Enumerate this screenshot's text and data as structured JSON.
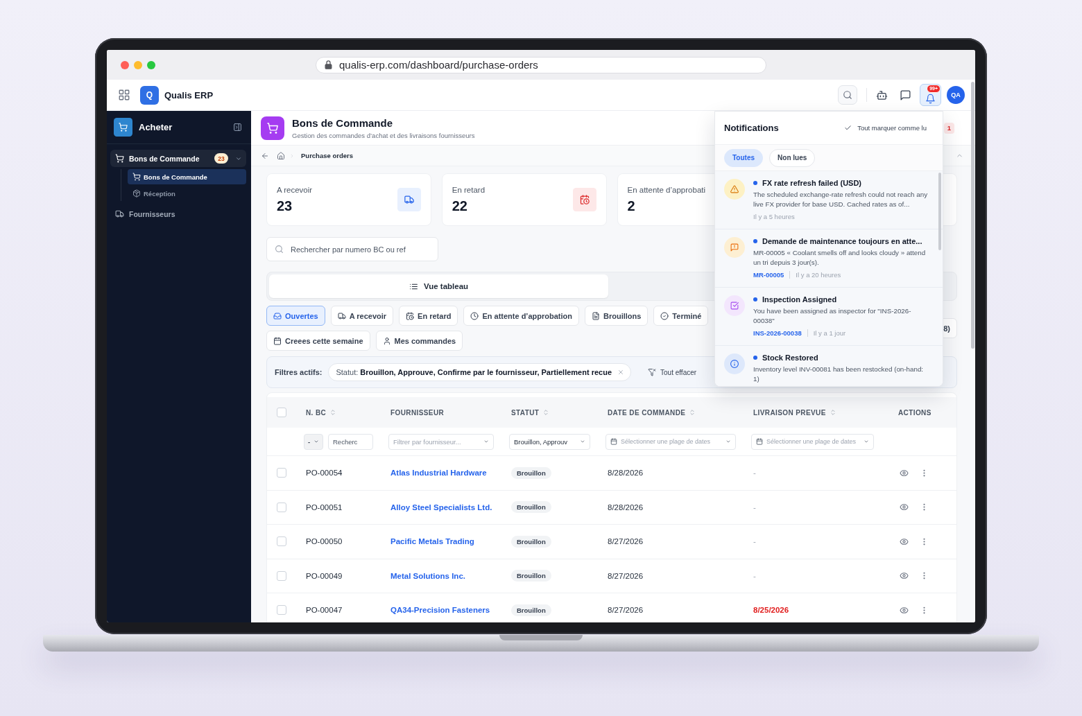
{
  "browser": {
    "url": "qualis-erp.com/dashboard/purchase-orders"
  },
  "app_header": {
    "logo": "Q",
    "brand": "Qualis ERP",
    "notification_count": "99+",
    "avatar": "QA"
  },
  "sidebar": {
    "title": "Acheter",
    "items": [
      {
        "label": "Bons de Commande",
        "badge": "23",
        "selected": true,
        "expanded": true,
        "children": [
          {
            "label": "Bons de Commande",
            "selected": true
          },
          {
            "label": "Réception",
            "selected": false
          }
        ]
      },
      {
        "label": "Fournisseurs",
        "selected": false
      }
    ]
  },
  "page_header": {
    "title": "Bons de Commande",
    "subtitle": "Gestion des commandes d’achat et des livraisons fournisseurs",
    "badge": "1"
  },
  "breadcrumb": {
    "current": "Purchase orders"
  },
  "stat_cards": [
    {
      "label": "A recevoir",
      "value": "23"
    },
    {
      "label": "En retard",
      "value": "22"
    },
    {
      "label": "En attente d’approbati",
      "value": "2"
    }
  ],
  "search": {
    "placeholder": "Rechercher par numero BC ou ref"
  },
  "view_toggle": [
    {
      "label": "Vue tableau",
      "selected": true
    }
  ],
  "filter_tabs": [
    {
      "label": "Ouvertes",
      "selected": true
    },
    {
      "label": "A recevoir",
      "selected": false
    },
    {
      "label": "En retard",
      "selected": false
    },
    {
      "label": "En attente d’approbation",
      "selected": false
    },
    {
      "label": "Brouillons",
      "selected": false
    },
    {
      "label": "Terminé",
      "selected": false
    },
    {
      "label": "Creees cette semaine",
      "selected": false
    },
    {
      "label": "Mes commandes",
      "selected": false
    }
  ],
  "right_tab": {
    "label": "8)"
  },
  "active_filters": {
    "label": "Filtres actifs:",
    "chips": [
      "Statut: **Brouillon, Approuve, Confirme par le fournisseur, Partiellement recue**"
    ],
    "clear": "Tout effacer"
  },
  "table": {
    "select_all_checked": false,
    "columns": [
      {
        "label": "N. BC",
        "sortable": true
      },
      {
        "label": "FOURNISSEUR",
        "sortable": false
      },
      {
        "label": "STATUT",
        "sortable": true
      },
      {
        "label": "DATE DE COMMANDE",
        "sortable": true
      },
      {
        "label": "LIVRAISON PREVUE",
        "sortable": true
      },
      {
        "label": "ACTIONS",
        "sortable": false
      }
    ],
    "column_filters": [
      {
        "kind": "text",
        "operator": "-",
        "placeholder": "Recherc"
      },
      {
        "kind": "select",
        "placeholder": "Filtrer par fournisseur..."
      },
      {
        "kind": "select",
        "value": "Brouillon, Approuv"
      },
      {
        "kind": "date_range",
        "placeholder": "Sélectionner une plage de dates"
      },
      {
        "kind": "date_range",
        "placeholder": "Sélectionner une plage de dates"
      }
    ],
    "rows": [
      {
        "checked": false,
        "po": "PO-00054",
        "supplier": "Atlas Industrial Hardware",
        "status": "Brouillon",
        "order_date": "8/28/2026",
        "delivery": "-",
        "overdue": false
      },
      {
        "checked": false,
        "po": "PO-00051",
        "supplier": "Alloy Steel Specialists Ltd.",
        "status": "Brouillon",
        "order_date": "8/28/2026",
        "delivery": "-",
        "overdue": false
      },
      {
        "checked": false,
        "po": "PO-00050",
        "supplier": "Pacific Metals Trading",
        "status": "Brouillon",
        "order_date": "8/27/2026",
        "delivery": "-",
        "overdue": false
      },
      {
        "checked": false,
        "po": "PO-00049",
        "supplier": "Metal Solutions Inc.",
        "status": "Brouillon",
        "order_date": "8/27/2026",
        "delivery": "-",
        "overdue": false
      },
      {
        "checked": false,
        "po": "PO-00047",
        "supplier": "QA34-Precision Fasteners",
        "status": "Brouillon",
        "order_date": "8/27/2026",
        "delivery": "8/25/2026",
        "overdue": true
      }
    ]
  },
  "notifications": {
    "open": true,
    "title": "Notifications",
    "mark_all": "Tout marquer comme lu",
    "filters": [
      {
        "label": "Toutes",
        "selected": true
      },
      {
        "label": "Non lues",
        "selected": false
      }
    ],
    "items": [
      {
        "kind": "warning",
        "unread": true,
        "title": "FX rate refresh failed (USD)",
        "body": "The scheduled exchange-rate refresh could not reach any live FX provider for base USD. Cached rates as of...",
        "time": "Il y a 5 heures"
      },
      {
        "kind": "maintenance",
        "unread": true,
        "title": "Demande de maintenance toujours en atte...",
        "body": "MR-00005 « Coolant smells off and looks cloudy » attend un tri depuis 3 jour(s).",
        "link": "MR-00005",
        "time": "Il y a 20 heures"
      },
      {
        "kind": "task",
        "unread": true,
        "title": "Inspection Assigned",
        "body": "You have been assigned as inspector for \"INS-2026-00038\"",
        "link": "INS-2026-00038",
        "time": "Il y a 1 jour"
      },
      {
        "kind": "info",
        "unread": true,
        "title": "Stock Restored",
        "body": "Inventory level INV-00081 has been restocked (on-hand: 1)"
      }
    ]
  }
}
